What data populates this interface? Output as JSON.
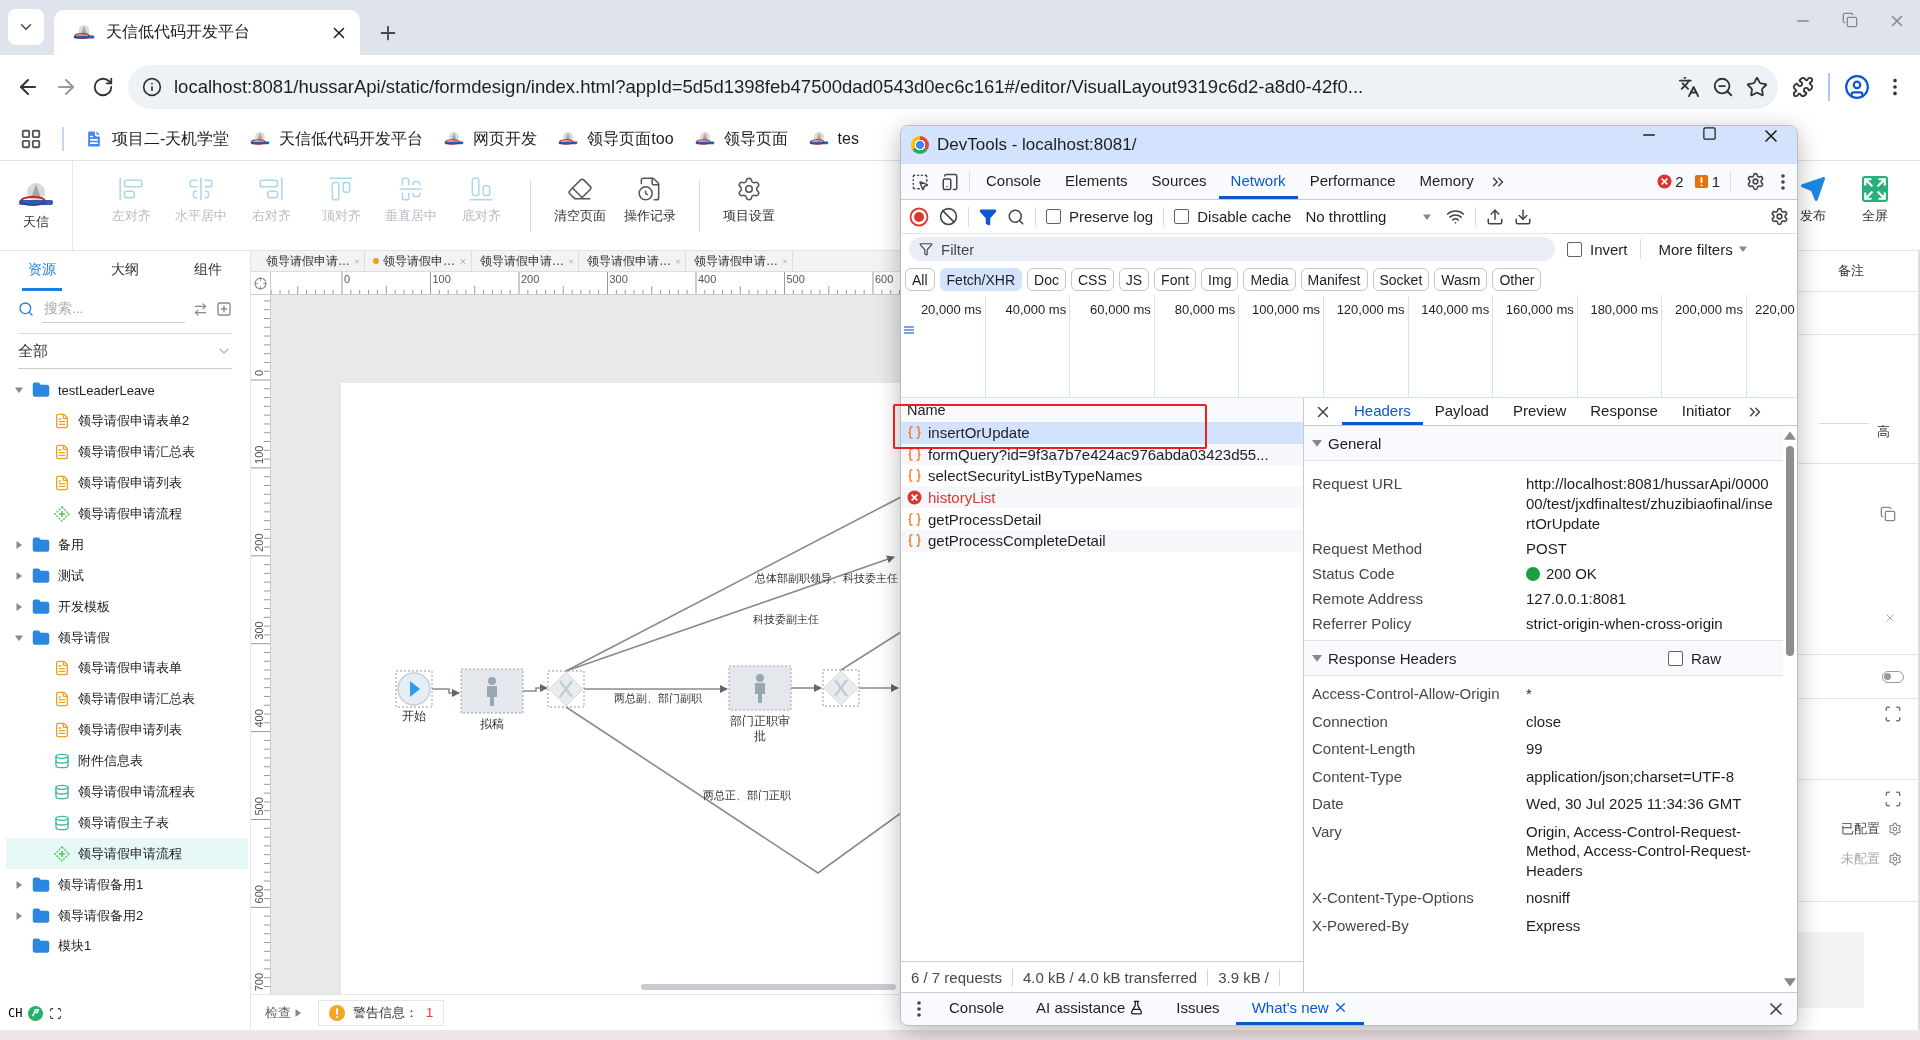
{
  "browser": {
    "tabs": [
      {
        "title": "天信低代码开发平台",
        "selected": true
      }
    ],
    "url": "localhost:8081/hussarApi/static/formdesign/index.html?appId=5d5d1398feb47500dad0543d0ec6c161#/editor/VisualLayout9319c6d2-a8d0-42f0...",
    "bookmarks": [
      {
        "label": "项目二-天机学堂",
        "kind": "doc"
      },
      {
        "label": "天信低代码开发平台",
        "kind": "logo"
      },
      {
        "label": "网页开发",
        "kind": "logo"
      },
      {
        "label": "领导页面too",
        "kind": "logo"
      },
      {
        "label": "领导页面",
        "kind": "logo"
      },
      {
        "label": "tes",
        "kind": "logo"
      }
    ]
  },
  "toolbar": {
    "logo": "天信",
    "tool_groups": [
      [
        {
          "label": "左对齐",
          "disabled": true
        },
        {
          "label": "水平居中",
          "disabled": true
        },
        {
          "label": "右对齐",
          "disabled": true
        },
        {
          "label": "顶对齐",
          "disabled": true
        },
        {
          "label": "垂直居中",
          "disabled": true
        },
        {
          "label": "底对齐",
          "disabled": true
        }
      ],
      [
        {
          "label": "清空页面",
          "disabled": false
        },
        {
          "label": "操作记录",
          "disabled": false
        }
      ],
      [
        {
          "label": "项目设置",
          "disabled": false
        }
      ]
    ],
    "right_tools": [
      "发布",
      "全屏"
    ]
  },
  "sidebar": {
    "tabs": [
      {
        "label": "资源",
        "selected": true
      },
      {
        "label": "大纲",
        "selected": false
      },
      {
        "label": "组件",
        "selected": false
      }
    ],
    "search": {
      "placeholder": "搜索..."
    },
    "filter": "全部",
    "tree": [
      {
        "label": "testLeaderLeave",
        "kind": "folder",
        "expanded": true,
        "selected": false,
        "children": [
          {
            "label": "领导请假申请表单2",
            "kind": "form",
            "selected": false
          },
          {
            "label": "领导请假申请汇总表",
            "kind": "form",
            "selected": false
          },
          {
            "label": "领导请假申请列表",
            "kind": "form",
            "selected": false
          },
          {
            "label": "领导请假申请流程",
            "kind": "flow",
            "selected": false
          }
        ]
      },
      {
        "label": "备用",
        "kind": "folder",
        "expanded": false,
        "selected": false
      },
      {
        "label": "测试",
        "kind": "folder",
        "expanded": false,
        "selected": false
      },
      {
        "label": "开发模板",
        "kind": "folder",
        "expanded": false,
        "selected": false
      },
      {
        "label": "领导请假",
        "kind": "folder",
        "expanded": true,
        "selected": false,
        "children": [
          {
            "label": "领导请假申请表单",
            "kind": "form",
            "selected": false
          },
          {
            "label": "领导请假申请汇总表",
            "kind": "form",
            "selected": false
          },
          {
            "label": "领导请假申请列表",
            "kind": "form",
            "selected": false
          },
          {
            "label": "附件信息表",
            "kind": "table",
            "selected": false
          },
          {
            "label": "领导请假申请流程表",
            "kind": "table",
            "selected": false
          },
          {
            "label": "领导请假主子表",
            "kind": "table",
            "selected": false
          },
          {
            "label": "领导请假申请流程",
            "kind": "flow",
            "selected": true
          }
        ]
      },
      {
        "label": "领导请假备用1",
        "kind": "folder",
        "expanded": false,
        "selected": false
      },
      {
        "label": "领导请假备用2",
        "kind": "folder",
        "expanded": false,
        "selected": false
      },
      {
        "label": "模块1",
        "kind": "folder",
        "selected": false
      }
    ],
    "input_indicator": "CH"
  },
  "editor_tabs": [
    {
      "label": "领导请假申请…",
      "modified": false
    },
    {
      "label": "领导请假申…",
      "modified": true
    },
    {
      "label": "领导请假申请…",
      "modified": false
    },
    {
      "label": "领导请假申请…",
      "modified": false
    },
    {
      "label": "领导请假申请…",
      "modified": false
    }
  ],
  "ruler": {
    "x_ticks": [
      "0",
      "100",
      "200",
      "300",
      "400",
      "500",
      "600"
    ],
    "y_ticks": [
      "0",
      "100",
      "200",
      "300",
      "400",
      "500",
      "600",
      "700"
    ]
  },
  "diagram": {
    "nodes": [
      {
        "kind": "start",
        "label": "开始"
      },
      {
        "kind": "task",
        "label": "拟稿"
      },
      {
        "kind": "gateway"
      },
      {
        "kind": "task",
        "label": "部门正职审批"
      },
      {
        "kind": "gateway"
      }
    ],
    "edge_labels": [
      "总体部副职领导、科技委主任",
      "科技委副主任",
      "两总副、部门副职",
      "两总正、部门正职"
    ]
  },
  "status_bar": {
    "inspect": "检查",
    "warning_label": "警告信息：",
    "warning_count": "1"
  },
  "right_panel": {
    "tab": "备注",
    "unit": "高",
    "toggle_on": false,
    "options": [
      {
        "label": "已配置",
        "configured": true
      },
      {
        "label": "未配置",
        "configured": false
      }
    ]
  },
  "devtools": {
    "title": "DevTools - localhost:8081/",
    "tabs": [
      {
        "label": "Console",
        "selected": false
      },
      {
        "label": "Elements",
        "selected": false
      },
      {
        "label": "Sources",
        "selected": false
      },
      {
        "label": "Network",
        "selected": true
      },
      {
        "label": "Performance",
        "selected": false
      },
      {
        "label": "Memory",
        "selected": false
      }
    ],
    "errors": "2",
    "warnings": "1",
    "preserve_log": false,
    "preserve_log_label": "Preserve log",
    "disable_cache": false,
    "disable_cache_label": "Disable cache",
    "throttling": "No throttling",
    "filter": {
      "placeholder": "Filter"
    },
    "invert": false,
    "invert_label": "Invert",
    "more_filters": "More filters",
    "type_filters": [
      {
        "label": "All",
        "selected": false
      },
      {
        "label": "Fetch/XHR",
        "selected": true
      },
      {
        "label": "Doc",
        "selected": false
      },
      {
        "label": "CSS",
        "selected": false
      },
      {
        "label": "JS",
        "selected": false
      },
      {
        "label": "Font",
        "selected": false
      },
      {
        "label": "Img",
        "selected": false
      },
      {
        "label": "Media",
        "selected": false
      },
      {
        "label": "Manifest",
        "selected": false
      },
      {
        "label": "Socket",
        "selected": false
      },
      {
        "label": "Wasm",
        "selected": false
      },
      {
        "label": "Other",
        "selected": false
      }
    ],
    "timeline": [
      "20,000 ms",
      "40,000 ms",
      "60,000 ms",
      "80,000 ms",
      "100,000 ms",
      "120,000 ms",
      "140,000 ms",
      "160,000 ms",
      "180,000 ms",
      "200,000 ms",
      "220,00"
    ],
    "requests": {
      "column": "Name",
      "rows": [
        {
          "name": "insertOrUpdate",
          "kind": "fetch",
          "selected": true
        },
        {
          "name": "formQuery?id=9f3a7b7e424ac976abda03423d55...",
          "kind": "fetch",
          "selected": false
        },
        {
          "name": "selectSecurityListByTypeNames",
          "kind": "fetch",
          "selected": false
        },
        {
          "name": "historyList",
          "kind": "error",
          "selected": false
        },
        {
          "name": "getProcessDetail",
          "kind": "fetch",
          "selected": false
        },
        {
          "name": "getProcessCompleteDetail",
          "kind": "fetch",
          "selected": false
        }
      ]
    },
    "summary": [
      "6 / 7 requests",
      "4.0 kB / 4.0 kB transferred",
      "3.9 kB /"
    ],
    "detail_tabs": [
      {
        "label": "Headers",
        "selected": true
      },
      {
        "label": "Payload",
        "selected": false
      },
      {
        "label": "Preview",
        "selected": false
      },
      {
        "label": "Response",
        "selected": false
      },
      {
        "label": "Initiator",
        "selected": false
      }
    ],
    "sections": [
      {
        "title": "General",
        "expanded": true,
        "rows": [
          {
            "label": "Request URL",
            "value": "http://localhost:8081/hussarApi/000000/test/jxdfinaltest/zhuzibiaofinal/insertOrUpdate"
          },
          {
            "label": "Request Method",
            "value": "POST"
          },
          {
            "label": "Status Code",
            "value": "200 OK",
            "ok": true
          },
          {
            "label": "Remote Address",
            "value": "127.0.0.1:8081"
          },
          {
            "label": "Referrer Policy",
            "value": "strict-origin-when-cross-origin"
          }
        ]
      },
      {
        "title": "Response Headers",
        "expanded": true,
        "raw": false,
        "raw_label": "Raw",
        "rows": [
          {
            "label": "Access-Control-Allow-Origin",
            "value": "*"
          },
          {
            "label": "Connection",
            "value": "close"
          },
          {
            "label": "Content-Length",
            "value": "99"
          },
          {
            "label": "Content-Type",
            "value": "application/json;charset=UTF-8"
          },
          {
            "label": "Date",
            "value": "Wed, 30 Jul 2025 11:34:36 GMT"
          },
          {
            "label": "Vary",
            "value": "Origin, Access-Control-Request-Method, Access-Control-Request-Headers"
          },
          {
            "label": "X-Content-Type-Options",
            "value": "nosniff"
          },
          {
            "label": "X-Powered-By",
            "value": "Express"
          }
        ]
      }
    ],
    "drawer": [
      {
        "label": "Console",
        "selected": false,
        "experimental": false,
        "closable": false
      },
      {
        "label": "AI assistance",
        "selected": false,
        "experimental": true,
        "closable": false
      },
      {
        "label": "Issues",
        "selected": false,
        "experimental": false,
        "closable": false
      },
      {
        "label": "What's new",
        "selected": true,
        "experimental": false,
        "closable": true
      }
    ]
  }
}
